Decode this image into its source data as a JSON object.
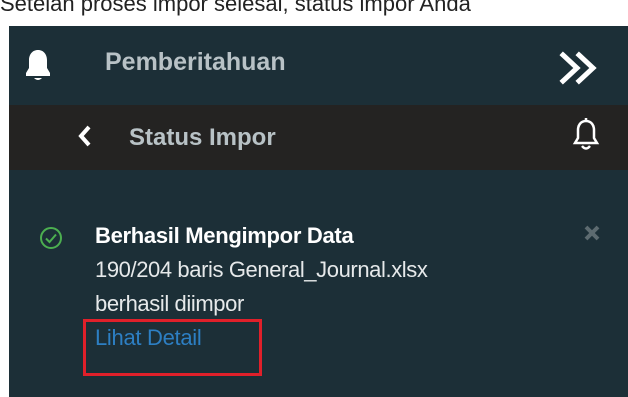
{
  "caption": "Setelah proses impor selesai, status impor Anda",
  "header": {
    "title": "Pemberitahuan",
    "bell_icon": "bell-icon",
    "expand_icon": "double-chevron-right-icon"
  },
  "subheader": {
    "title": "Status Impor",
    "back_icon": "chevron-left-icon",
    "bell_icon": "bell-outline-icon"
  },
  "notification": {
    "status_icon": "check-circle-icon",
    "title": "Berhasil Mengimpor Data",
    "line1": "190/204 baris General_Journal.xlsx",
    "line2": "berhasil diimpor",
    "link_label": "Lihat Detail",
    "close_icon": "close-icon",
    "highlight_color": "#e0202a",
    "success_color": "#4caf50",
    "link_color": "#2d7fc3"
  }
}
